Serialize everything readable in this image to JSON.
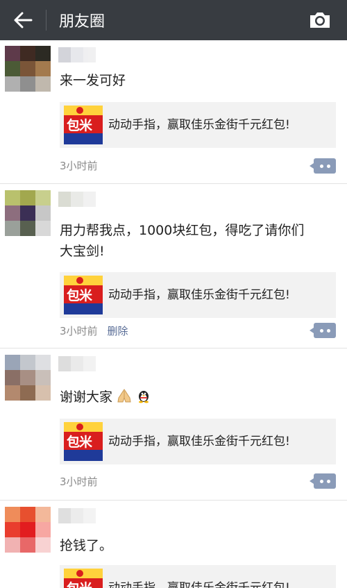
{
  "header": {
    "title": "朋友圈",
    "back_icon": "back-arrow-icon",
    "camera_icon": "camera-icon"
  },
  "colors": {
    "topbar": "#383c41",
    "link": "#576b95",
    "meta": "#8a8a8a",
    "card_bg": "#f2f2f2"
  },
  "share_card": {
    "text": "动动手指，赢取佳乐金街千元红包!",
    "thumb_text": "包米"
  },
  "posts": [
    {
      "avatar_colors": [
        "#5e3a4a",
        "#3f2a22",
        "#2c2a23",
        "#4b5a36",
        "#7a5538",
        "#a37a4e",
        "#b0b0b0",
        "#8f8f8f",
        "#c0b8ad"
      ],
      "name_blur_colors": [
        "#cfd0d6",
        "#e5e6ea",
        "#eeeef0"
      ],
      "text_lines": [
        "来一发可好"
      ],
      "time": "3小时前",
      "delete_label": ""
    },
    {
      "avatar_colors": [
        "#b9c16d",
        "#a2a84e",
        "#c8cf8d",
        "#8d6e7e",
        "#3b2f55",
        "#c7c7c7",
        "#9aa09a",
        "#586050",
        "#d8d8d8"
      ],
      "name_blur_colors": [
        "#d6d9cf",
        "#e7e8e5",
        "#f0f0f0"
      ],
      "text_lines": [
        "用力帮我点，1000块红包，得吃了请你们",
        "大宝剑!"
      ],
      "time": "3小时前",
      "delete_label": "删除"
    },
    {
      "avatar_colors": [
        "#9aa5b7",
        "#c3c7cd",
        "#dedfe2",
        "#8a6f66",
        "#a88f84",
        "#c9bfb9",
        "#b3896e",
        "#8e6b52",
        "#d7c0ad"
      ],
      "name_blur_colors": [
        "#dadada",
        "#e8e8e8",
        "#f1f1f1"
      ],
      "text_lines": [
        "谢谢大家"
      ],
      "time": "3小时前",
      "delete_label": ""
    },
    {
      "avatar_colors": [
        "#ef8c5a",
        "#e7502f",
        "#f3b89a",
        "#e93d2e",
        "#e21d1f",
        "#f7a7a2",
        "#f1b2b2",
        "#e86868",
        "#f8d2d2"
      ],
      "name_blur_colors": [
        "#dcdcdc",
        "#eaeaea",
        "#f2f2f2"
      ],
      "text_lines": [
        "抢钱了。"
      ],
      "time": "",
      "delete_label": ""
    }
  ]
}
